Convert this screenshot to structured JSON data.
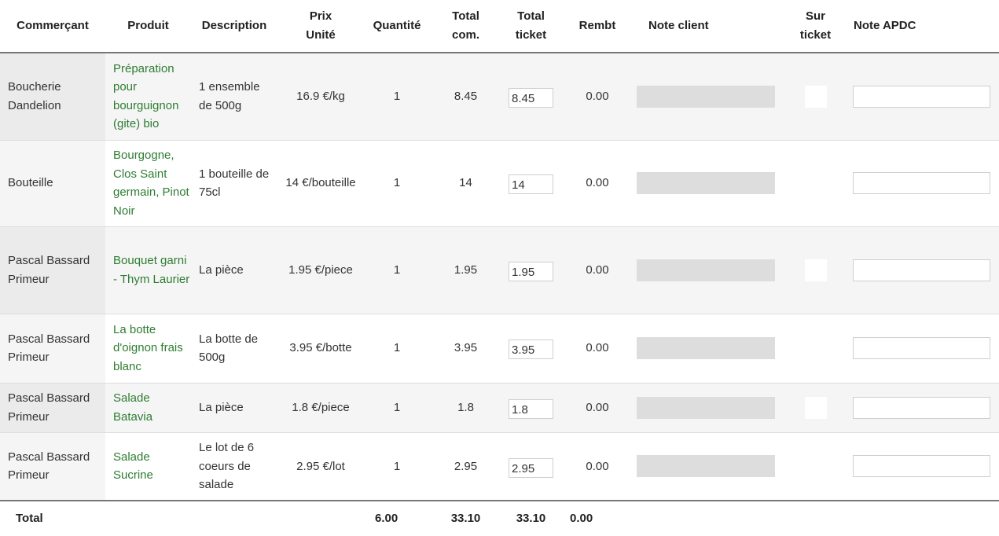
{
  "headers": {
    "merchant": "Commerçant",
    "product": "Produit",
    "description": "Description",
    "unit_price_line1": "Prix",
    "unit_price_line2": "Unité",
    "quantity": "Quantité",
    "total_order_line1": "Total",
    "total_order_line2": "com.",
    "total_ticket_line1": "Total",
    "total_ticket_line2": "ticket",
    "refund": "Rembt",
    "client_note": "Note client",
    "on_ticket_line1": "Sur",
    "on_ticket_line2": "ticket",
    "apdc_note": "Note APDC"
  },
  "rows": [
    {
      "merchant": "Boucherie Dandelion",
      "product": "Préparation pour bourguignon (gite) bio",
      "description": "1 ensemble de 500g",
      "unit_price": "16.9 €/kg",
      "quantity": "1",
      "total_order": "8.45",
      "total_ticket": "8.45",
      "refund": "0.00"
    },
    {
      "merchant": "Bouteille",
      "product": "Bourgogne, Clos Saint germain, Pinot Noir",
      "description": "1 bouteille de 75cl",
      "unit_price": "14 €/bouteille",
      "quantity": "1",
      "total_order": "14",
      "total_ticket": "14",
      "refund": "0.00"
    },
    {
      "merchant": "Pascal Bassard Primeur",
      "product": "Bouquet garni - Thym Laurier",
      "description": "La pièce",
      "unit_price": "1.95 €/piece",
      "quantity": "1",
      "total_order": "1.95",
      "total_ticket": "1.95",
      "refund": "0.00"
    },
    {
      "merchant": "Pascal Bassard Primeur",
      "product": "La botte d'oignon frais blanc",
      "description": "La botte de 500g",
      "unit_price": "3.95 €/botte",
      "quantity": "1",
      "total_order": "3.95",
      "total_ticket": "3.95",
      "refund": "0.00"
    },
    {
      "merchant": "Pascal Bassard Primeur",
      "product": "Salade Batavia",
      "description": "La pièce",
      "unit_price": "1.8 €/piece",
      "quantity": "1",
      "total_order": "1.8",
      "total_ticket": "1.8",
      "refund": "0.00"
    },
    {
      "merchant": "Pascal Bassard Primeur",
      "product": "Salade Sucrine",
      "description": "Le lot de 6 coeurs de salade",
      "unit_price": "2.95 €/lot",
      "quantity": "1",
      "total_order": "2.95",
      "total_ticket": "2.95",
      "refund": "0.00"
    }
  ],
  "footer": {
    "label": "Total",
    "quantity": "6.00",
    "total_order": "33.10",
    "total_ticket": "33.10",
    "refund": "0.00"
  }
}
